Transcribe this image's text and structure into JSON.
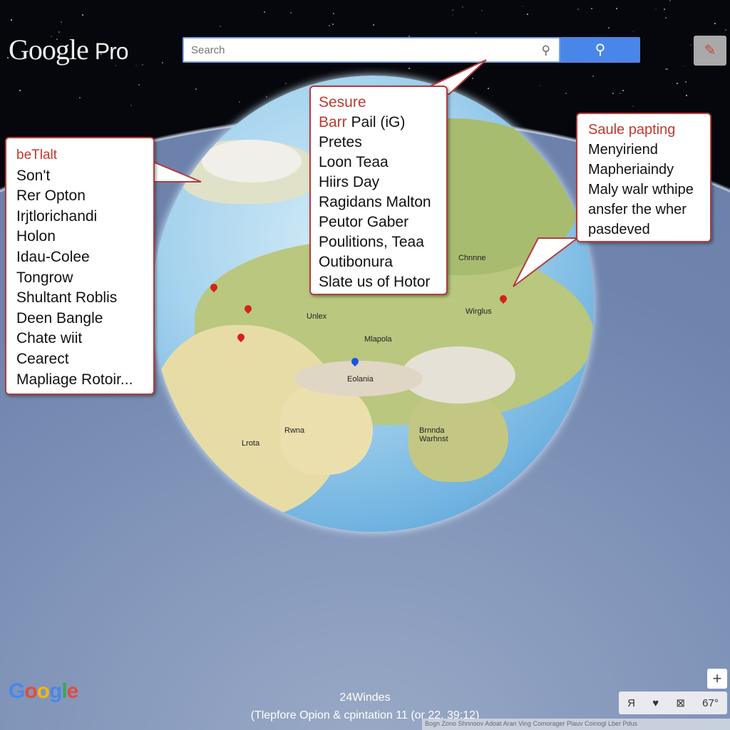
{
  "header": {
    "logo": "Google",
    "logo_suffix": "Pro",
    "search_placeholder": "Search",
    "search_icon": "magnifier-icon",
    "tool_icon": "ruler-icon"
  },
  "callouts": {
    "left": {
      "title": "beTlalt",
      "items": [
        "Son't",
        "Rer Opton",
        "Irjtlorichandi",
        "Holon",
        "Idau-Colee",
        "Tongrow",
        "Shultant Roblis",
        "Deen Bangle",
        "Chate wiit",
        "Cearect",
        "Mapliage Rotoir..."
      ]
    },
    "center": {
      "title": "Sesure",
      "subtitle_red": "Barr",
      "subtitle": "Pail (iG)",
      "items": [
        "Pretes",
        "Loon Teaa",
        "Hiirs Day",
        "Ragidans Malton",
        "Peutor Gaber",
        "Poulitions, Teaa",
        "Outibonura",
        "Slate us of Hotor"
      ]
    },
    "right": {
      "title": "Saule papting",
      "items": [
        "Menyiriend",
        "Mapheriaindy",
        "Maly walr wthipe",
        "ansfer the wher",
        "pasdeved"
      ]
    }
  },
  "map_labels": [
    "Unlex",
    "Mlapola",
    "Eolania",
    "Chnnne",
    "Brnnda Warhnst",
    "Lrota",
    "Rwna",
    "Wirglus"
  ],
  "bottom": {
    "logo": "Google",
    "status_line1": "24Windes",
    "status_line2": "(Tlepfore Opion & cpintation 11 (or 22, 39:12)",
    "zoom_in": "+",
    "controls": [
      "Я",
      "♥",
      "⊠",
      "67°"
    ],
    "footer": "Bogn Zono  Shnnoov  Adoat  Aran Ving  Comorager Plauv  Coinogl Lber  Pdus"
  },
  "colors": {
    "accent": "#4a86e8",
    "callout_border": "#b33c3c",
    "red_text": "#c0392b"
  }
}
